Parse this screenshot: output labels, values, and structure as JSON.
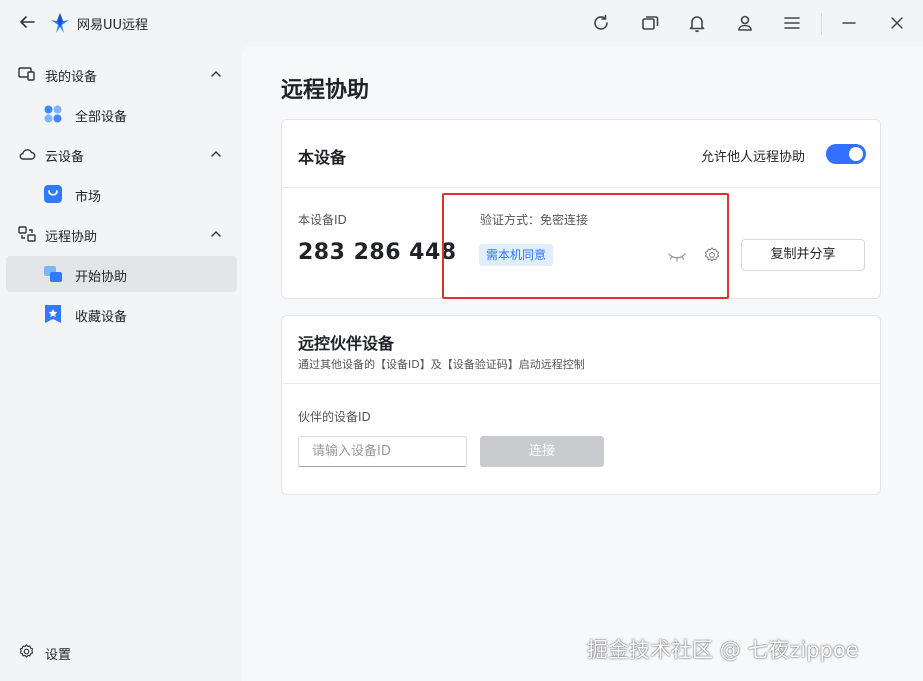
{
  "titlebar": {
    "app_title": "网易UU远程",
    "icons": [
      "back-arrow-icon",
      "app-logo-icon",
      "refresh-icon",
      "window-icon",
      "bell-icon",
      "user-icon",
      "menu-icon",
      "minimize-icon",
      "close-icon"
    ]
  },
  "sidebar": {
    "groups": [
      {
        "label": "我的设备",
        "icon": "devices-icon",
        "items": [
          {
            "label": "全部设备",
            "icon": "grid-icon"
          }
        ]
      },
      {
        "label": "云设备",
        "icon": "cloud-icon",
        "items": [
          {
            "label": "市场",
            "icon": "shopping-bag-icon"
          }
        ]
      },
      {
        "label": "远程协助",
        "icon": "remote-icon",
        "items": [
          {
            "label": "开始协助",
            "icon": "start-assist-icon",
            "active": true
          },
          {
            "label": "收藏设备",
            "icon": "star-bookmark-icon"
          }
        ]
      }
    ],
    "settings_label": "设置"
  },
  "main": {
    "page_title": "远程协助",
    "this_device": {
      "title": "本设备",
      "allow_label": "允许他人远程协助",
      "allow_enabled": true,
      "device_id_label": "本设备ID",
      "device_id": "283 286 448",
      "verify_label": "验证方式：免密连接",
      "verify_badge": "需本机同意",
      "copy_share_button": "复制并分享"
    },
    "partner": {
      "title": "远控伙伴设备",
      "description": "通过其他设备的【设备ID】及【设备验证码】启动远程控制",
      "device_id_label": "伙伴的设备ID",
      "input_placeholder": "请输入设备ID",
      "connect_button": "连接"
    }
  },
  "watermark": "掘金技术社区 @ 七夜zippoe",
  "colors": {
    "accent": "#3370ff",
    "highlight_box": "#e03131",
    "badge_bg": "#e0efff"
  }
}
